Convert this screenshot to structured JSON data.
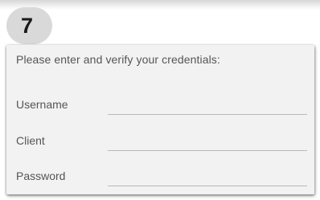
{
  "step": {
    "number": "7"
  },
  "form": {
    "prompt": "Please enter and verify your credentials:",
    "fields": [
      {
        "label": "Username",
        "value": ""
      },
      {
        "label": "Client",
        "value": ""
      },
      {
        "label": "Password",
        "value": ""
      }
    ]
  }
}
